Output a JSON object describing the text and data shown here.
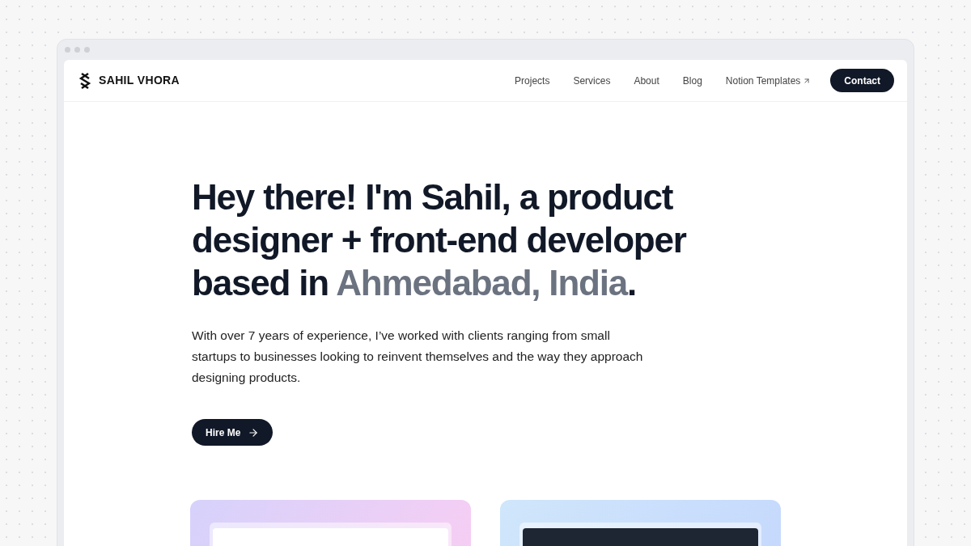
{
  "logo": {
    "text": "SAHIL VHORA"
  },
  "nav": [
    {
      "label": "Projects",
      "external": false
    },
    {
      "label": "Services",
      "external": false
    },
    {
      "label": "About",
      "external": false
    },
    {
      "label": "Blog",
      "external": false
    },
    {
      "label": "Notion Templates",
      "external": true
    }
  ],
  "contact_button": "Contact",
  "headline": [
    {
      "text": "Hey there! I'm Sahil, a product designer + front-end developer based in ",
      "muted": false
    },
    {
      "text": "Ahmedabad, India",
      "muted": true
    },
    {
      "text": ".",
      "muted": false
    }
  ],
  "intro": "With over 7 years of experience, I’ve worked with clients ranging from small startups to businesses looking to reinvent themselves and the way they approach designing products.",
  "hire_button": "Hire Me",
  "projects": [
    {
      "kind": "light"
    },
    {
      "kind": "dark"
    }
  ]
}
